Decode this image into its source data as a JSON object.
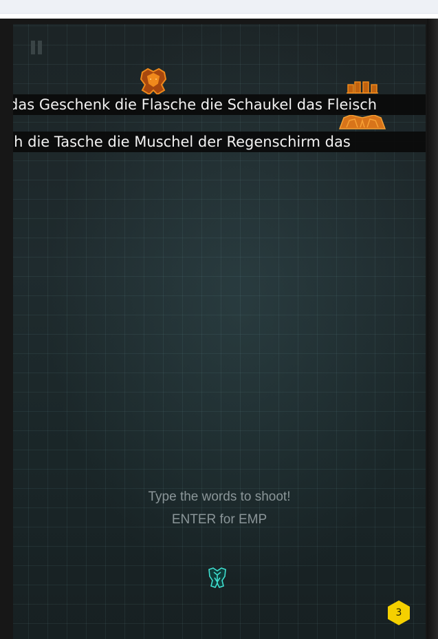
{
  "game": {
    "word_rows": [
      "das Geschenk die Flasche die Schaukel das Fleisch",
      "Fleisch die Tasche die Muschel der Regenschirm das"
    ],
    "hint_line1": "Type the words to shoot!",
    "hint_line2": "ENTER for EMP",
    "emp_count": "3"
  },
  "colors": {
    "background": "#1f2b2e",
    "grid": "#78aaaf",
    "enemy": "#f08a1c",
    "player": "#3fe0d0",
    "emp_badge": "#f5d000",
    "word_bar": "#0a0a0a",
    "word_text": "#f2f2f2",
    "hint_text": "#8b9699"
  },
  "icons": {
    "pause": "pause-icon",
    "enemy": "alien-ship-icon",
    "player": "player-ship-icon",
    "emp": "hexagon-badge-icon"
  }
}
